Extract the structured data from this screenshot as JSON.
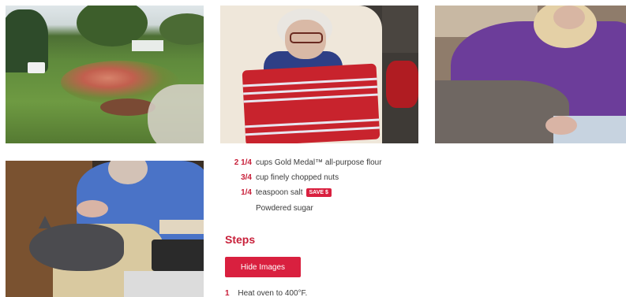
{
  "photos": [
    {
      "subject": "garden"
    },
    {
      "subject": "woman-with-red-pillow"
    },
    {
      "subject": "purple-shirt"
    },
    {
      "subject": "cat-on-lap"
    }
  ],
  "recipe": {
    "ingredients": [
      {
        "qty": "2 1/4",
        "desc": "cups Gold Medal™ all-purpose flour"
      },
      {
        "qty": "3/4",
        "desc": "cup finely chopped nuts"
      },
      {
        "qty": "1/4",
        "desc": "teaspoon salt",
        "badge": "SAVE $"
      },
      {
        "qty": "",
        "desc": "Powdered sugar"
      }
    ],
    "steps_heading": "Steps",
    "hide_images_label": "Hide Images",
    "steps": [
      {
        "num": "1",
        "text": "Heat oven to 400°F."
      }
    ]
  },
  "colors": {
    "accent": "#d9203f",
    "heading": "#c8203a",
    "text": "#3b3b3b"
  }
}
